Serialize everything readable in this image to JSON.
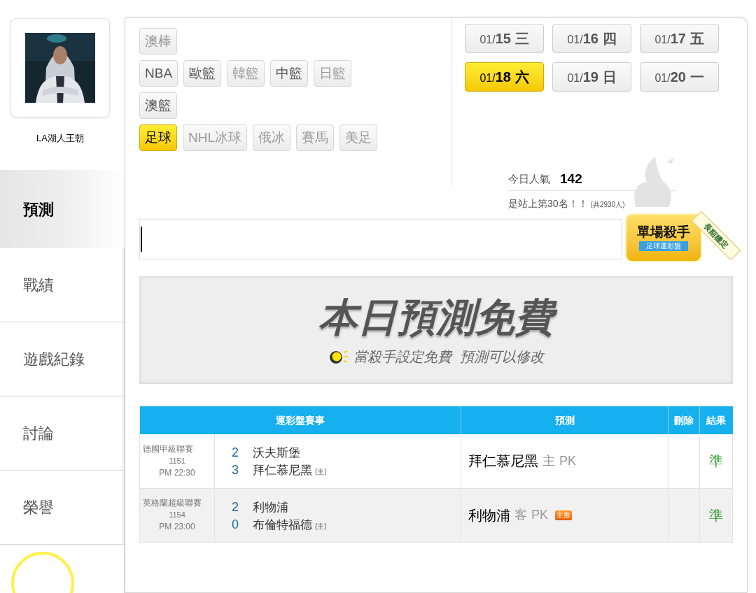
{
  "profile": {
    "name": "LA湖人王朝"
  },
  "nav": [
    {
      "label": "預測",
      "selected": true
    },
    {
      "label": "戰績",
      "selected": false
    },
    {
      "label": "遊戲紀錄",
      "selected": false
    },
    {
      "label": "討論",
      "selected": false
    },
    {
      "label": "榮譽",
      "selected": false
    }
  ],
  "sports": [
    [
      {
        "label": "澳棒",
        "disabled": true,
        "selected": false
      }
    ],
    [
      {
        "label": "NBA",
        "disabled": false,
        "selected": false
      },
      {
        "label": "歐籃",
        "disabled": false,
        "selected": false
      },
      {
        "label": "韓籃",
        "disabled": true,
        "selected": false
      },
      {
        "label": "中籃",
        "disabled": false,
        "selected": false
      },
      {
        "label": "日籃",
        "disabled": true,
        "selected": false
      }
    ],
    [
      {
        "label": "澳籃",
        "disabled": false,
        "selected": false
      }
    ],
    [
      {
        "label": "足球",
        "disabled": false,
        "selected": true
      },
      {
        "label": "NHL冰球",
        "disabled": true,
        "selected": false
      },
      {
        "label": "俄冰",
        "disabled": true,
        "selected": false
      },
      {
        "label": "賽馬",
        "disabled": true,
        "selected": false
      },
      {
        "label": "美足",
        "disabled": true,
        "selected": false
      }
    ]
  ],
  "dates": [
    {
      "month": "01/",
      "day": "15",
      "weekday": "三",
      "selected": false
    },
    {
      "month": "01/",
      "day": "16",
      "weekday": "四",
      "selected": false
    },
    {
      "month": "01/",
      "day": "17",
      "weekday": "五",
      "selected": false
    },
    {
      "month": "01/",
      "day": "18",
      "weekday": "六",
      "selected": true
    },
    {
      "month": "01/",
      "day": "19",
      "weekday": "日",
      "selected": false
    },
    {
      "month": "01/",
      "day": "20",
      "weekday": "一",
      "selected": false
    }
  ],
  "stats": {
    "popularity_label": "今日人氣",
    "popularity": "142",
    "rank": "是站上第30名！！",
    "total": "(共2930人)"
  },
  "badge": {
    "title": "單場殺手",
    "subtitle": "足球運彩盤",
    "ribbon": "長期穩定"
  },
  "banner": {
    "title": "本日預測免費",
    "subtitle": "當殺手設定免費  預測可以修改"
  },
  "table": {
    "columns": [
      "運彩盤賽事",
      "預測",
      "刪除",
      "結果"
    ],
    "rows": [
      {
        "league": "德國甲級聯賽",
        "code": "1151",
        "time": "PM 22:30",
        "teams": [
          {
            "score": "2",
            "name": "沃夫斯堡"
          },
          {
            "score": "3",
            "name": "拜仁慕尼黑",
            "mark": "(主)"
          }
        ],
        "pick": {
          "team": "拜仁慕尼黑",
          "side": "主",
          "line": "PK"
        },
        "result": "準"
      },
      {
        "league": "英格蘭超級聯賽",
        "code": "1154",
        "time": "PM 23:00",
        "teams": [
          {
            "score": "2",
            "name": "利物浦"
          },
          {
            "score": "0",
            "name": "布倫特福德",
            "mark": "(主)"
          }
        ],
        "pick": {
          "team": "利物浦",
          "side": "客",
          "line": "PK",
          "tag": "主推"
        },
        "result": "準"
      }
    ]
  }
}
